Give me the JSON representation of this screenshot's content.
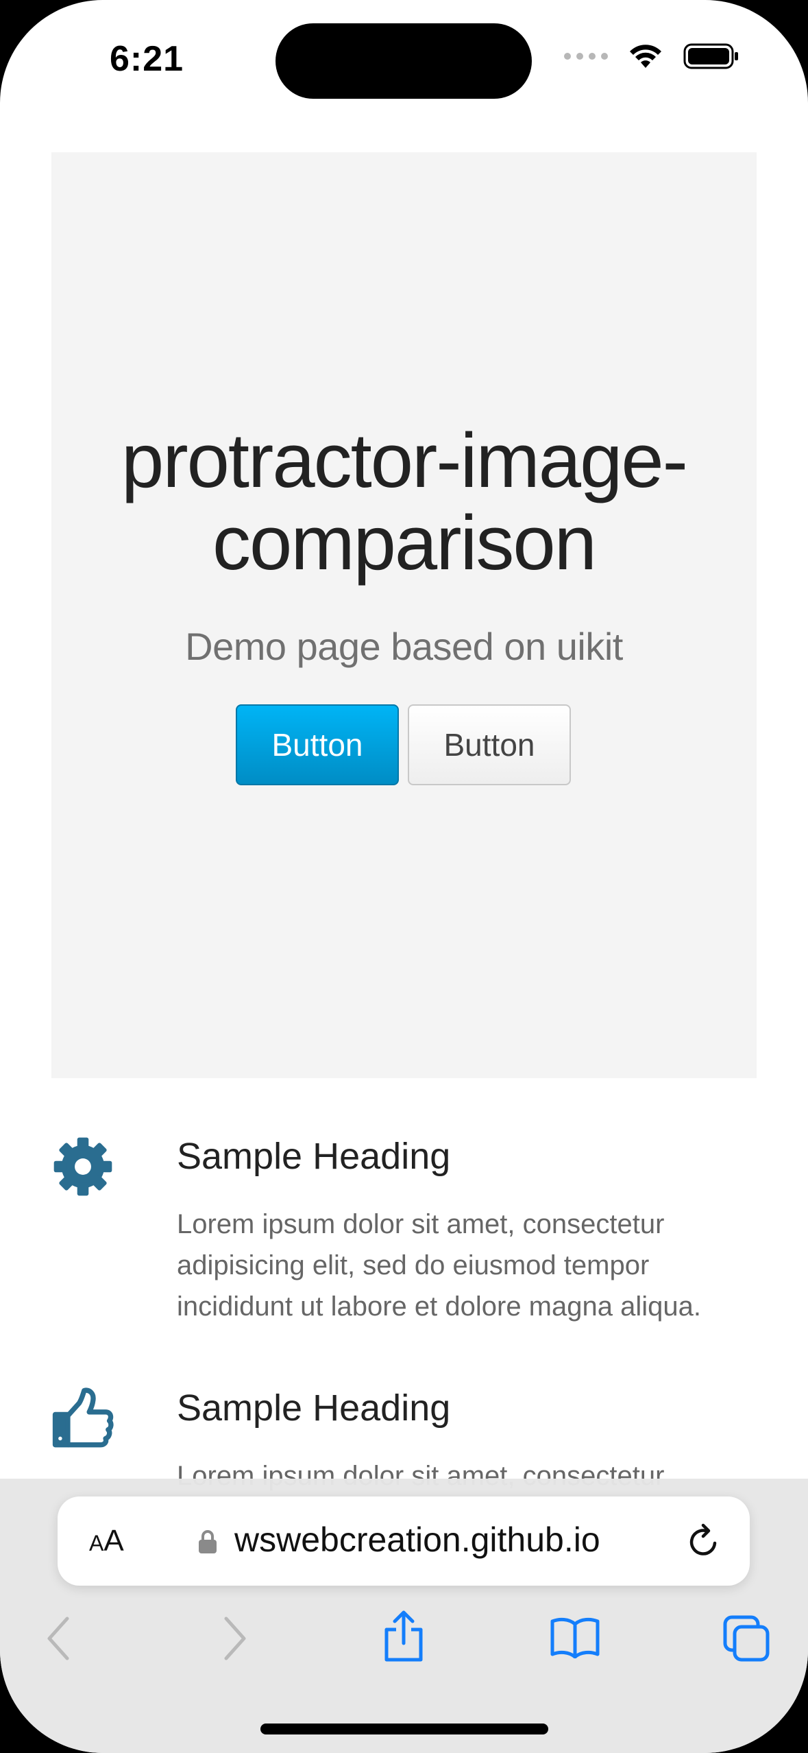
{
  "status_bar": {
    "time": "6:21"
  },
  "hero": {
    "title": "protractor-image-comparison",
    "subtitle": "Demo page based on uikit",
    "primary_button": "Button",
    "default_button": "Button"
  },
  "features": [
    {
      "icon": "gear-icon",
      "heading": "Sample Heading",
      "text": "Lorem ipsum dolor sit amet, consectetur adipisicing elit, sed do eiusmod tempor incididunt ut labore et dolore magna aliqua."
    },
    {
      "icon": "thumbs-up-icon",
      "heading": "Sample Heading",
      "text": "Lorem ipsum dolor sit amet, consectetur"
    }
  ],
  "browser": {
    "text_size_label": "AA",
    "url": "wswebcreation.github.io",
    "accent_color": "#147efb",
    "toolbar_icons": [
      "back-icon",
      "forward-icon",
      "share-icon",
      "bookmarks-icon",
      "tabs-icon"
    ]
  },
  "colors": {
    "primary_button": "#009dd8",
    "feature_icon": "#2a6d90",
    "hero_background": "#f4f4f4"
  }
}
